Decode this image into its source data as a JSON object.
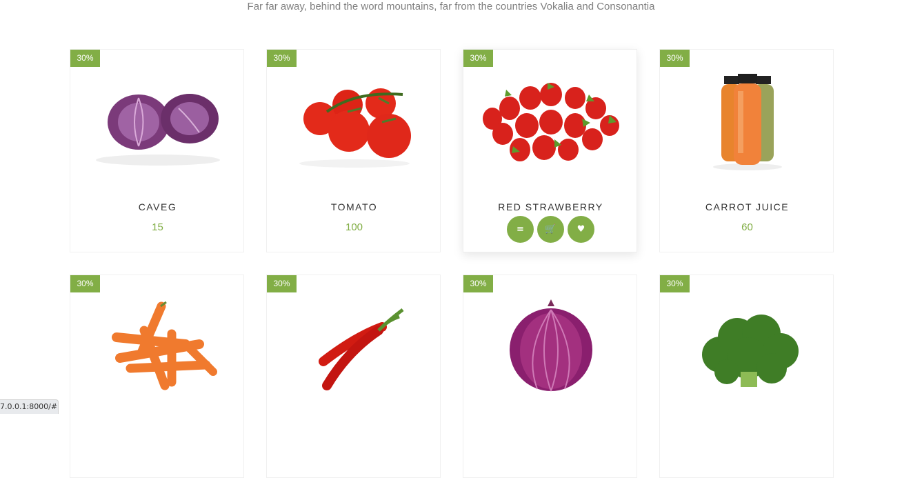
{
  "section": {
    "subtitle": "Far far away, behind the word mountains, far from the countries Vokalia and Consonantia"
  },
  "colors": {
    "accent": "#82ae46"
  },
  "products": [
    {
      "badge": "30%",
      "name": "CAVEG",
      "price": "15",
      "image": "red-cabbage"
    },
    {
      "badge": "30%",
      "name": "TOMATO",
      "price": "100",
      "image": "tomato"
    },
    {
      "badge": "30%",
      "name": "RED STRAWBERRY",
      "price": "",
      "image": "strawberry",
      "hovered": true,
      "actions": [
        {
          "icon": "menu-icon",
          "glyph": "≡"
        },
        {
          "icon": "cart-icon",
          "glyph": "🛒"
        },
        {
          "icon": "heart-icon",
          "glyph": "♥"
        }
      ]
    },
    {
      "badge": "30%",
      "name": "CARROT JUICE",
      "price": "60",
      "image": "juice-bottles"
    },
    {
      "badge": "30%",
      "name": "",
      "price": "",
      "image": "carrots"
    },
    {
      "badge": "30%",
      "name": "",
      "price": "",
      "image": "chili-peppers"
    },
    {
      "badge": "30%",
      "name": "",
      "price": "",
      "image": "red-onion"
    },
    {
      "badge": "30%",
      "name": "",
      "price": "",
      "image": "broccoli"
    }
  ],
  "status_bar": {
    "url": "7.0.0.1:8000/#"
  }
}
